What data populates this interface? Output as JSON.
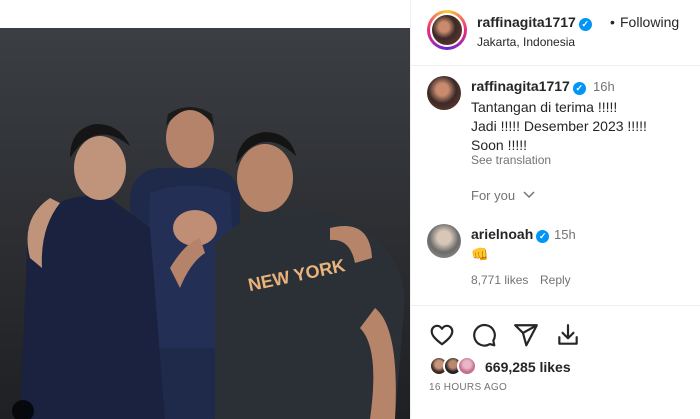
{
  "post": {
    "username": "raffinagita1717",
    "follow_status": "Following",
    "separator": "•",
    "location": "Jakarta, Indonesia"
  },
  "caption": {
    "username": "raffinagita1717",
    "time": "16h",
    "lines": [
      "Tantangan di terima !!!!!",
      "Jadi !!!!! Desember 2023 !!!!!",
      "Soon !!!!!"
    ],
    "see_translation": "See translation"
  },
  "for_you": "For you",
  "comment": {
    "username": "arielnoah",
    "time": "15h",
    "text": "👊",
    "likes": "8,771 likes",
    "reply": "Reply"
  },
  "actions": {
    "like_icon": "heart-icon",
    "comment_icon": "comment-icon",
    "share_icon": "share-icon",
    "save_icon": "save-icon"
  },
  "likes_count": "669,285 likes",
  "time_ago": "16 HOURS AGO",
  "photo": {
    "jersey_text": "NEW YORK",
    "icon": "user-tag-icon"
  },
  "colors": {
    "verified": "#0095f6",
    "secondary_text": "#737373",
    "border": "#efefef"
  }
}
